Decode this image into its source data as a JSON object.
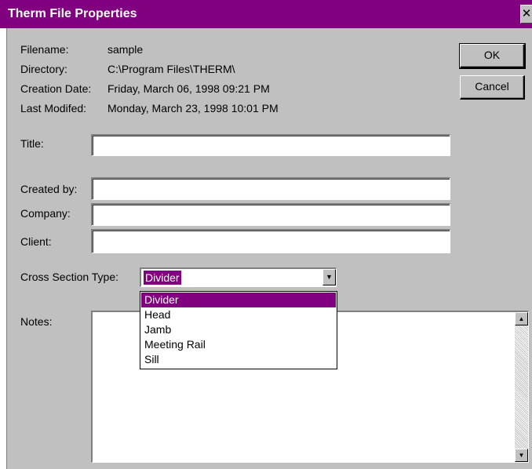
{
  "window": {
    "title": "Therm File Properties",
    "close_glyph": "✕"
  },
  "info": {
    "filename_label": "Filename:",
    "filename_value": "sample",
    "directory_label": "Directory:",
    "directory_value": "C:\\Program Files\\THERM\\",
    "creation_label": "Creation Date:",
    "creation_value": "Friday, March 06, 1998 09:21 PM",
    "modified_label": "Last Modifed:",
    "modified_value": "Monday, March 23, 1998 10:01 PM"
  },
  "buttons": {
    "ok": "OK",
    "cancel": "Cancel"
  },
  "fields": {
    "title_label": "Title:",
    "title_value": "",
    "created_by_label": "Created by:",
    "created_by_value": "",
    "company_label": "Company:",
    "company_value": "",
    "client_label": "Client:",
    "client_value": ""
  },
  "cross_section": {
    "label": "Cross Section Type:",
    "selected": "Divider",
    "options": [
      "Divider",
      "Head",
      "Jamb",
      "Meeting Rail",
      "Sill"
    ]
  },
  "notes": {
    "label": "Notes:",
    "value": ""
  },
  "colors": {
    "title_bar": "#800080",
    "selection": "#800080",
    "dialog_face": "#c0c0c0"
  }
}
